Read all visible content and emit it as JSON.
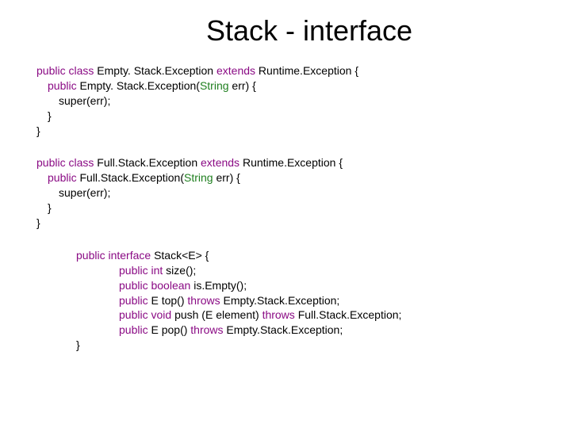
{
  "title": "Stack - interface",
  "block1": {
    "l1a": "public",
    "l1b": "class",
    "l1c": "Empty. Stack.Exception",
    "l1d": "extends",
    "l1e": "Runtime.Exception {",
    "l2a": "public",
    "l2b": "Empty. Stack.Exception(",
    "l2c": "String ",
    "l2d": "err) {",
    "l3": "super(err);",
    "l4": "}",
    "l5": "}"
  },
  "block2": {
    "l1a": "public",
    "l1b": "class",
    "l1c": "Full.Stack.Exception",
    "l1d": "extends",
    "l1e": "Runtime.Exception {",
    "l2a": "public",
    "l2b": "Full.Stack.Exception(",
    "l2c": "String ",
    "l2d": "err) {",
    "l3": "super(err);",
    "l4": "}",
    "l5": "}"
  },
  "block3": {
    "l1a": "public",
    "l1b": "interface",
    "l1c": "Stack<E> {",
    "l2a": "public",
    "l2b": "int",
    "l2c": "size();",
    "l3a": "public",
    "l3b": "boolean",
    "l3c": "is.Empty();",
    "l4a": "public",
    "l4b": "E top()",
    "l4c": "throws",
    "l4d": "Empty.Stack.Exception;",
    "l5a": "public",
    "l5b": "void",
    "l5c": "push (E element)",
    "l5d": "throws",
    "l5e": "Full.Stack.Exception;",
    "l6a": "public",
    "l6b": "E pop()",
    "l6c": "throws",
    "l6d": "Empty.Stack.Exception;",
    "l7": "}"
  }
}
